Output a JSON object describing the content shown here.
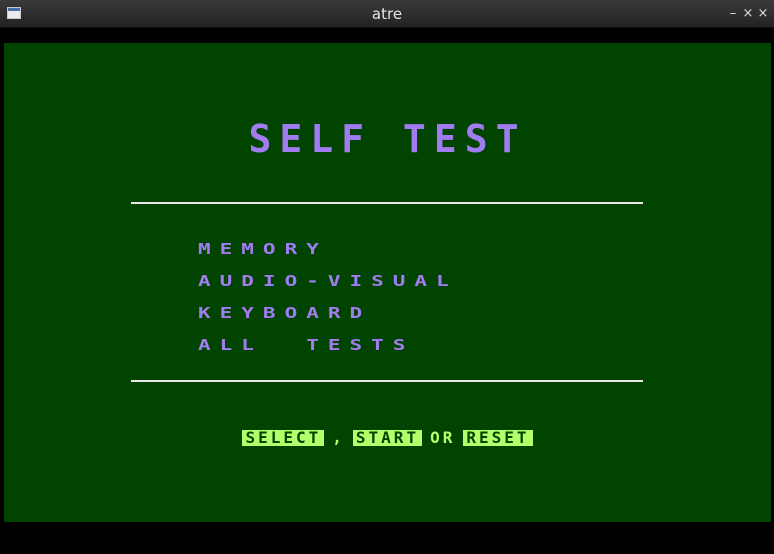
{
  "window": {
    "title": "atre",
    "app_icon": "window-icon",
    "controls": {
      "minimize": "–",
      "maximize": "×",
      "close": "×"
    }
  },
  "screen": {
    "background_color": "#004400",
    "text_color": "#a07cf0",
    "highlight_color": "#b4ff6a",
    "heading": "SELF TEST",
    "menu": [
      {
        "label": "MEMORY"
      },
      {
        "label": "AUDIO-VISUAL"
      },
      {
        "label": "KEYBOARD"
      },
      {
        "label": "ALL  TESTS"
      }
    ],
    "footer": {
      "select_key": "SELECT",
      "comma": ",",
      "start_key": "START",
      "or_text": "OR",
      "reset_key": "RESET"
    }
  }
}
